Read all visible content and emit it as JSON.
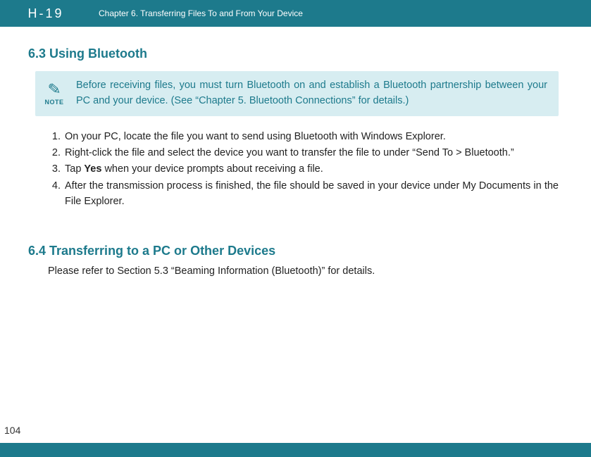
{
  "header": {
    "logo": "H-19",
    "chapter_title": "Chapter 6. Transferring Files To and From Your Device"
  },
  "section63": {
    "heading": "6.3 Using Bluetooth",
    "note_label": "NOTE",
    "note_text": "Before receiving files, you must turn Bluetooth on and establish a Bluetooth partnership between your PC and your device. (See “Chapter 5. Bluetooth Connections” for details.)",
    "steps": [
      {
        "n": "1.",
        "text": "On your PC, locate the file you want to send using Bluetooth with Windows Explorer."
      },
      {
        "n": "2.",
        "text": "Right-click the file and select the device you want to transfer the file to under “Send To > Bluetooth.”"
      },
      {
        "n": "3.",
        "pre": "Tap ",
        "bold": "Yes",
        "post": " when your device prompts about receiving a file."
      },
      {
        "n": "4.",
        "text": "After the transmission process is finished, the file should be saved in your device under My Documents in the File Explorer."
      }
    ]
  },
  "section64": {
    "heading": "6.4 Transferring to a PC or Other Devices",
    "body": "Please refer to Section 5.3 “Beaming Information (Bluetooth)” for details."
  },
  "page_number": "104"
}
